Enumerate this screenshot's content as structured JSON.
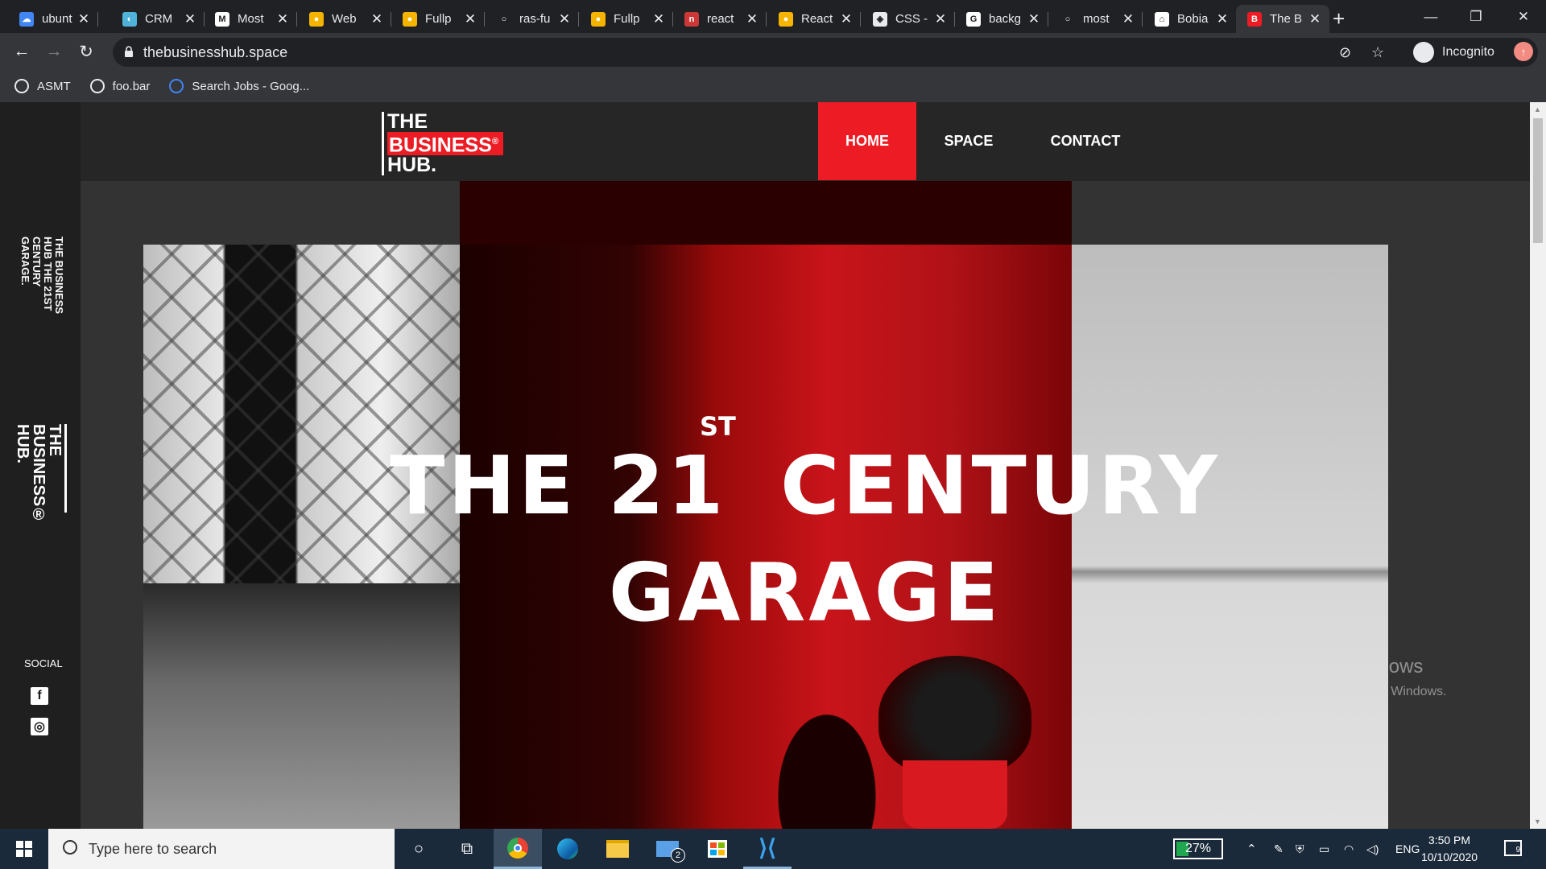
{
  "browser": {
    "tabs": [
      {
        "title": "ubunt",
        "fav_color": "#4285f4",
        "fav_glyph": "☁"
      },
      {
        "title": "CRM",
        "fav_color": "#4fb3d9",
        "fav_glyph": "◐"
      },
      {
        "title": "Most",
        "fav_color": "#ffffff",
        "fav_glyph": "M"
      },
      {
        "title": "Web",
        "fav_color": "#f5b400",
        "fav_glyph": "●"
      },
      {
        "title": "Fullp",
        "fav_color": "#f5b400",
        "fav_glyph": "●"
      },
      {
        "title": "ras-fu",
        "fav_color": "#202124",
        "fav_glyph": "○"
      },
      {
        "title": "Fullp",
        "fav_color": "#f5b400",
        "fav_glyph": "●"
      },
      {
        "title": "react",
        "fav_color": "#cb3837",
        "fav_glyph": "n"
      },
      {
        "title": "React",
        "fav_color": "#f5b400",
        "fav_glyph": "●"
      },
      {
        "title": "CSS -",
        "fav_color": "#e8eaed",
        "fav_glyph": "◈"
      },
      {
        "title": "backg",
        "fav_color": "#ffffff",
        "fav_glyph": "G"
      },
      {
        "title": "most",
        "fav_color": "#202124",
        "fav_glyph": "○"
      },
      {
        "title": "Bobia",
        "fav_color": "#ffffff",
        "fav_glyph": "⌂"
      },
      {
        "title": "The B",
        "fav_color": "#ed1c24",
        "fav_glyph": "B"
      }
    ],
    "new_tab": "+",
    "window_controls": {
      "minimize": "—",
      "restore": "❐",
      "close": "✕"
    },
    "nav": {
      "back": "←",
      "forward": "→",
      "reload": "↻"
    },
    "url": "thebusinesshub.space",
    "incognito_label": "Incognito",
    "bookmarks": [
      {
        "label": "ASMT"
      },
      {
        "label": "foo.bar"
      },
      {
        "label": "Search Jobs - Goog..."
      }
    ]
  },
  "site": {
    "logo": {
      "line1": "THE",
      "line2": "BUSINESS",
      "line2_mark": "®",
      "line3": "HUB."
    },
    "nav": [
      {
        "label": "HOME",
        "active": true
      },
      {
        "label": "SPACE",
        "active": false
      },
      {
        "label": "CONTACT",
        "active": false
      }
    ],
    "side_tagline": "THE BUSINESS HUB THE 21ST CENTURY GARAGE.",
    "side_logo": "THE BUSINESS® HUB.",
    "social_label": "SOCIAL",
    "social": [
      {
        "name": "facebook",
        "glyph": "f"
      },
      {
        "name": "instagram",
        "glyph": "◎"
      }
    ],
    "hero": {
      "line1_a": "THE 21",
      "superscript": "ST",
      "line1_b": "CENTURY",
      "line2": "GARAGE"
    },
    "accent_color": "#ed1c24"
  },
  "watermark": {
    "title": "Activate Windows",
    "subtitle": "Go to Settings to activate Windows."
  },
  "taskbar": {
    "search_placeholder": "Type here to search",
    "mail_badge": "2",
    "battery": "27%",
    "battery_level": 0.27,
    "language": "ENG",
    "time": "3:50 PM",
    "date": "10/10/2020",
    "notifications": "9"
  }
}
